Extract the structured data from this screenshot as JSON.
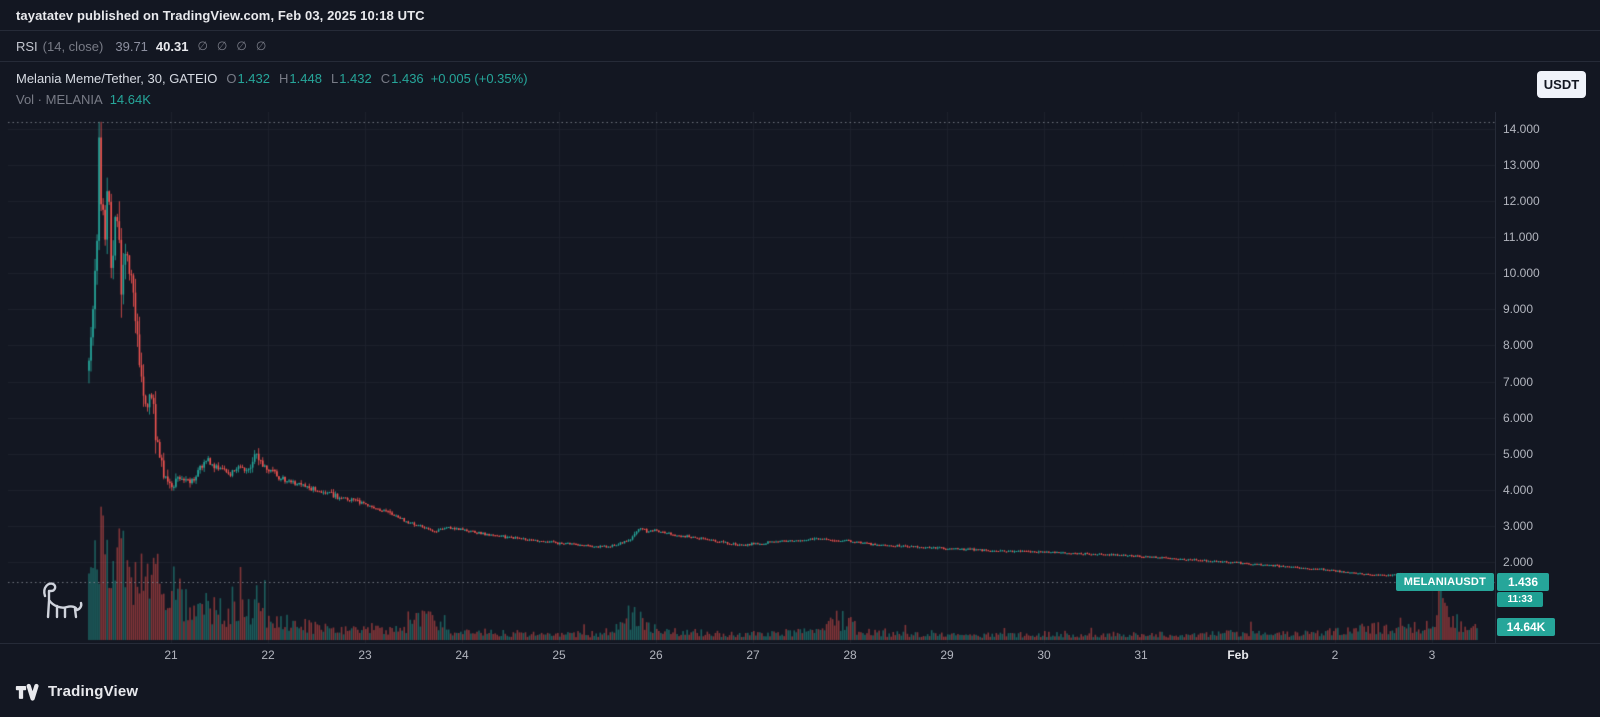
{
  "colors": {
    "bg": "#131722",
    "border": "#262b38",
    "grid": "#1e222d",
    "up": "#26a69a",
    "down": "#ef5350",
    "up_vol": "rgba(38,166,154,0.5)",
    "down_vol": "rgba(239,83,80,0.5)",
    "dashed_line": "rgba(130,134,145,0.85)",
    "text_muted": "#787b86",
    "scale_text": "#b2b5be"
  },
  "publish_bar": {
    "text": "tayatatev published on TradingView.com, Feb 03, 2025 10:18 UTC"
  },
  "rsi_legend": {
    "title": "RSI",
    "params": "(14, close)",
    "value1": "39.71",
    "value2": "40.31",
    "empty_values": [
      "∅",
      "∅",
      "∅",
      "∅"
    ]
  },
  "symbol_legend": {
    "title": "Melania Meme/Tether, 30, GATEIO",
    "o_label": "O",
    "o": "1.432",
    "h_label": "H",
    "h": "1.448",
    "l_label": "L",
    "l": "1.432",
    "c_label": "C",
    "c": "1.436",
    "change": "+0.005 (+0.35%)"
  },
  "volume_legend": {
    "label": "Vol · MELANIA",
    "value": "14.64K"
  },
  "quote_currency_button": "USDT",
  "price_labels": {
    "symbol_badge": "MELANIAUSDT",
    "last_price": "1.436",
    "countdown": "11:33",
    "volume_badge": "14.64K"
  },
  "footer": {
    "brand": "TradingView"
  },
  "chart_data": {
    "type": "candlestick",
    "title": "Melania Meme/Tether, 30, GATEIO",
    "symbol": "MELANIAUSDT",
    "exchange": "GATEIO",
    "interval_minutes": 30,
    "quote_currency": "USDT",
    "last_bar": {
      "open": 1.432,
      "high": 1.448,
      "low": 1.432,
      "close": 1.436,
      "change": 0.005,
      "change_pct": 0.35,
      "volume": "14.64K"
    },
    "rsi": {
      "length": 14,
      "source": "close",
      "value": 39.71,
      "ma_value": 40.31
    },
    "y_axis": {
      "ticks": [
        14,
        13,
        12,
        11,
        10,
        9,
        8,
        7,
        6,
        5,
        4,
        3,
        2
      ],
      "decimals": 3,
      "range_shown": [
        1.2,
        14.4
      ]
    },
    "x_axis": {
      "labels": [
        {
          "t": 1,
          "label": "21"
        },
        {
          "t": 2,
          "label": "22"
        },
        {
          "t": 3,
          "label": "23"
        },
        {
          "t": 4,
          "label": "24"
        },
        {
          "t": 5,
          "label": "25"
        },
        {
          "t": 6,
          "label": "26"
        },
        {
          "t": 7,
          "label": "27"
        },
        {
          "t": 8,
          "label": "28"
        },
        {
          "t": 9,
          "label": "29"
        },
        {
          "t": 10,
          "label": "30"
        },
        {
          "t": 11,
          "label": "31"
        },
        {
          "t": 12,
          "label": "Feb"
        },
        {
          "t": 13,
          "label": "2"
        },
        {
          "t": 14,
          "label": "3"
        }
      ]
    },
    "ath_dashed_line_price": 14.2,
    "price_line": 1.436,
    "start_t": 0.144,
    "end_t": 14.47,
    "price_anchors": [
      [
        0.14,
        7.2
      ],
      [
        0.18,
        8.2
      ],
      [
        0.22,
        9.2
      ],
      [
        0.25,
        11.5
      ],
      [
        0.27,
        13.3
      ],
      [
        0.3,
        12.0
      ],
      [
        0.33,
        11.2
      ],
      [
        0.36,
        12.5
      ],
      [
        0.4,
        10.4
      ],
      [
        0.45,
        11.9
      ],
      [
        0.5,
        9.6
      ],
      [
        0.55,
        10.9
      ],
      [
        0.6,
        9.9
      ],
      [
        0.65,
        8.6
      ],
      [
        0.7,
        7.1
      ],
      [
        0.76,
        6.2
      ],
      [
        0.81,
        6.7
      ],
      [
        0.86,
        5.5
      ],
      [
        0.92,
        4.7
      ],
      [
        0.97,
        4.2
      ],
      [
        1.02,
        4.0
      ],
      [
        1.09,
        4.4
      ],
      [
        1.2,
        4.15
      ],
      [
        1.3,
        4.55
      ],
      [
        1.38,
        4.85
      ],
      [
        1.45,
        4.6
      ],
      [
        1.53,
        4.65
      ],
      [
        1.61,
        4.35
      ],
      [
        1.71,
        4.7
      ],
      [
        1.79,
        4.5
      ],
      [
        1.88,
        4.95
      ],
      [
        1.94,
        4.75
      ],
      [
        2.0,
        4.6
      ],
      [
        2.12,
        4.35
      ],
      [
        2.28,
        4.2
      ],
      [
        2.43,
        4.05
      ],
      [
        2.59,
        3.95
      ],
      [
        2.74,
        3.8
      ],
      [
        2.9,
        3.7
      ],
      [
        3.0,
        3.6
      ],
      [
        3.15,
        3.45
      ],
      [
        3.31,
        3.3
      ],
      [
        3.46,
        3.1
      ],
      [
        3.62,
        2.95
      ],
      [
        3.72,
        2.85
      ],
      [
        3.88,
        2.95
      ],
      [
        4.0,
        2.9
      ],
      [
        4.19,
        2.8
      ],
      [
        4.39,
        2.72
      ],
      [
        4.6,
        2.65
      ],
      [
        4.8,
        2.58
      ],
      [
        5.0,
        2.52
      ],
      [
        5.22,
        2.48
      ],
      [
        5.42,
        2.42
      ],
      [
        5.58,
        2.45
      ],
      [
        5.73,
        2.6
      ],
      [
        5.84,
        2.95
      ],
      [
        5.92,
        2.85
      ],
      [
        6.0,
        2.88
      ],
      [
        6.14,
        2.78
      ],
      [
        6.35,
        2.7
      ],
      [
        6.56,
        2.62
      ],
      [
        6.76,
        2.52
      ],
      [
        6.92,
        2.46
      ],
      [
        7.0,
        2.5
      ],
      [
        7.23,
        2.55
      ],
      [
        7.48,
        2.6
      ],
      [
        7.69,
        2.65
      ],
      [
        7.9,
        2.6
      ],
      [
        8.0,
        2.58
      ],
      [
        8.21,
        2.5
      ],
      [
        8.46,
        2.45
      ],
      [
        8.72,
        2.42
      ],
      [
        9.0,
        2.38
      ],
      [
        9.29,
        2.34
      ],
      [
        9.65,
        2.3
      ],
      [
        10.0,
        2.28
      ],
      [
        10.33,
        2.24
      ],
      [
        10.69,
        2.2
      ],
      [
        11.0,
        2.16
      ],
      [
        11.31,
        2.1
      ],
      [
        11.62,
        2.05
      ],
      [
        12.0,
        1.98
      ],
      [
        12.29,
        1.92
      ],
      [
        12.6,
        1.85
      ],
      [
        12.86,
        1.8
      ],
      [
        13.0,
        1.76
      ],
      [
        13.27,
        1.68
      ],
      [
        13.53,
        1.62
      ],
      [
        13.68,
        1.66
      ],
      [
        13.83,
        1.6
      ],
      [
        14.0,
        1.56
      ],
      [
        14.2,
        1.5
      ],
      [
        14.35,
        1.47
      ],
      [
        14.47,
        1.44
      ]
    ],
    "volume_anchors": [
      [
        0.14,
        0.5
      ],
      [
        0.2,
        0.85
      ],
      [
        0.27,
        1.0
      ],
      [
        0.35,
        0.7
      ],
      [
        0.45,
        0.85
      ],
      [
        0.55,
        0.6
      ],
      [
        0.65,
        0.75
      ],
      [
        0.75,
        0.5
      ],
      [
        0.85,
        0.65
      ],
      [
        0.95,
        0.45
      ],
      [
        1.05,
        0.5
      ],
      [
        1.15,
        0.35
      ],
      [
        1.3,
        0.4
      ],
      [
        1.45,
        0.3
      ],
      [
        1.6,
        0.25
      ],
      [
        1.8,
        0.3
      ],
      [
        2.0,
        0.22
      ],
      [
        2.3,
        0.15
      ],
      [
        2.6,
        0.12
      ],
      [
        3.0,
        0.1
      ],
      [
        3.4,
        0.09
      ],
      [
        3.65,
        0.28
      ],
      [
        3.8,
        0.1
      ],
      [
        4.0,
        0.08
      ],
      [
        4.5,
        0.07
      ],
      [
        5.0,
        0.06
      ],
      [
        5.5,
        0.06
      ],
      [
        5.85,
        0.26
      ],
      [
        6.0,
        0.1
      ],
      [
        6.5,
        0.07
      ],
      [
        7.0,
        0.06
      ],
      [
        7.5,
        0.08
      ],
      [
        7.95,
        0.22
      ],
      [
        8.1,
        0.08
      ],
      [
        8.5,
        0.06
      ],
      [
        9.0,
        0.05
      ],
      [
        9.5,
        0.05
      ],
      [
        10.0,
        0.06
      ],
      [
        10.5,
        0.05
      ],
      [
        11.0,
        0.06
      ],
      [
        11.5,
        0.05
      ],
      [
        12.0,
        0.07
      ],
      [
        12.5,
        0.06
      ],
      [
        13.0,
        0.08
      ],
      [
        13.4,
        0.12
      ],
      [
        13.9,
        0.1
      ],
      [
        14.05,
        0.3
      ],
      [
        14.12,
        0.7
      ],
      [
        14.2,
        0.25
      ],
      [
        14.35,
        0.12
      ],
      [
        14.47,
        0.1
      ]
    ]
  }
}
